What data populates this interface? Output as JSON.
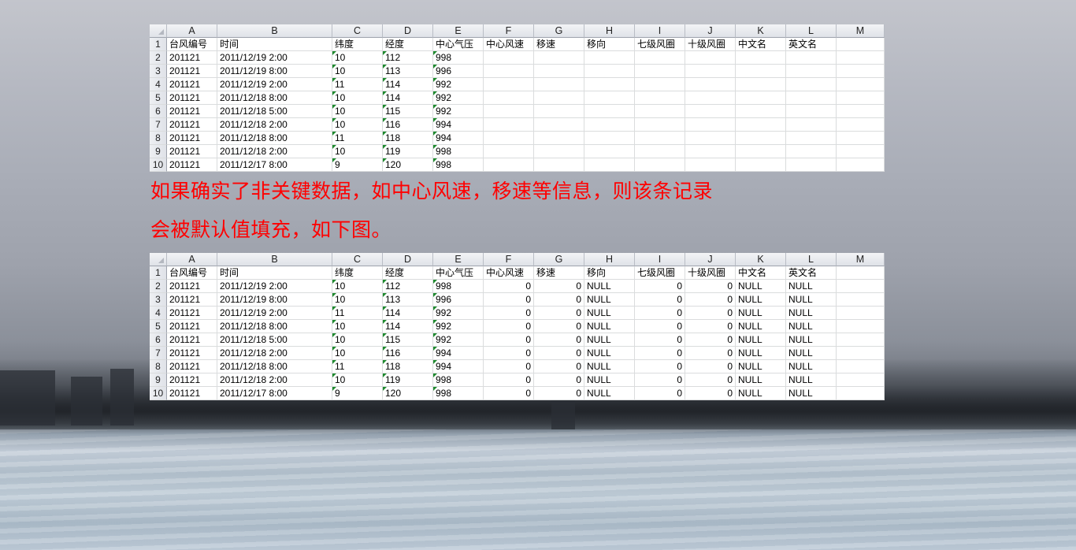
{
  "columns": [
    "A",
    "B",
    "C",
    "D",
    "E",
    "F",
    "G",
    "H",
    "I",
    "J",
    "K",
    "L",
    "M"
  ],
  "headers": [
    "台风编号",
    "时间",
    "纬度",
    "经度",
    "中心气压",
    "中心风速",
    "移速",
    "移向",
    "七级风圈",
    "十级风圈",
    "中文名",
    "英文名",
    ""
  ],
  "caption": {
    "line1": "如果确实了非关键数据，如中心风速，移速等信息，则该条记录",
    "line2": "会被默认值填充，如下图。"
  },
  "table_before": {
    "rows": [
      {
        "n": "2",
        "cells": [
          "201121",
          "2011/12/19 2:00",
          "10",
          "112",
          "998",
          "",
          "",
          "",
          "",
          "",
          "",
          "",
          ""
        ]
      },
      {
        "n": "3",
        "cells": [
          "201121",
          "2011/12/19 8:00",
          "10",
          "113",
          "996",
          "",
          "",
          "",
          "",
          "",
          "",
          "",
          ""
        ]
      },
      {
        "n": "4",
        "cells": [
          "201121",
          "2011/12/19 2:00",
          "11",
          "114",
          "992",
          "",
          "",
          "",
          "",
          "",
          "",
          "",
          ""
        ]
      },
      {
        "n": "5",
        "cells": [
          "201121",
          "2011/12/18 8:00",
          "10",
          "114",
          "992",
          "",
          "",
          "",
          "",
          "",
          "",
          "",
          ""
        ]
      },
      {
        "n": "6",
        "cells": [
          "201121",
          "2011/12/18 5:00",
          "10",
          "115",
          "992",
          "",
          "",
          "",
          "",
          "",
          "",
          "",
          ""
        ]
      },
      {
        "n": "7",
        "cells": [
          "201121",
          "2011/12/18 2:00",
          "10",
          "116",
          "994",
          "",
          "",
          "",
          "",
          "",
          "",
          "",
          ""
        ]
      },
      {
        "n": "8",
        "cells": [
          "201121",
          "2011/12/18 8:00",
          "11",
          "118",
          "994",
          "",
          "",
          "",
          "",
          "",
          "",
          "",
          ""
        ]
      },
      {
        "n": "9",
        "cells": [
          "201121",
          "2011/12/18 2:00",
          "10",
          "119",
          "998",
          "",
          "",
          "",
          "",
          "",
          "",
          "",
          ""
        ]
      },
      {
        "n": "10",
        "cells": [
          "201121",
          "2011/12/17 8:00",
          "9",
          "120",
          "998",
          "",
          "",
          "",
          "",
          "",
          "",
          "",
          ""
        ]
      }
    ]
  },
  "table_after": {
    "rows": [
      {
        "n": "2",
        "cells": [
          "201121",
          "2011/12/19 2:00",
          "10",
          "112",
          "998",
          "0",
          "0",
          "NULL",
          "0",
          "0",
          "NULL",
          "NULL",
          ""
        ]
      },
      {
        "n": "3",
        "cells": [
          "201121",
          "2011/12/19 8:00",
          "10",
          "113",
          "996",
          "0",
          "0",
          "NULL",
          "0",
          "0",
          "NULL",
          "NULL",
          ""
        ]
      },
      {
        "n": "4",
        "cells": [
          "201121",
          "2011/12/19 2:00",
          "11",
          "114",
          "992",
          "0",
          "0",
          "NULL",
          "0",
          "0",
          "NULL",
          "NULL",
          ""
        ]
      },
      {
        "n": "5",
        "cells": [
          "201121",
          "2011/12/18 8:00",
          "10",
          "114",
          "992",
          "0",
          "0",
          "NULL",
          "0",
          "0",
          "NULL",
          "NULL",
          ""
        ]
      },
      {
        "n": "6",
        "cells": [
          "201121",
          "2011/12/18 5:00",
          "10",
          "115",
          "992",
          "0",
          "0",
          "NULL",
          "0",
          "0",
          "NULL",
          "NULL",
          ""
        ]
      },
      {
        "n": "7",
        "cells": [
          "201121",
          "2011/12/18 2:00",
          "10",
          "116",
          "994",
          "0",
          "0",
          "NULL",
          "0",
          "0",
          "NULL",
          "NULL",
          ""
        ]
      },
      {
        "n": "8",
        "cells": [
          "201121",
          "2011/12/18 8:00",
          "11",
          "118",
          "994",
          "0",
          "0",
          "NULL",
          "0",
          "0",
          "NULL",
          "NULL",
          ""
        ]
      },
      {
        "n": "9",
        "cells": [
          "201121",
          "2011/12/18 2:00",
          "10",
          "119",
          "998",
          "0",
          "0",
          "NULL",
          "0",
          "0",
          "NULL",
          "NULL",
          ""
        ]
      },
      {
        "n": "10",
        "cells": [
          "201121",
          "2011/12/17 8:00",
          "9",
          "120",
          "998",
          "0",
          "0",
          "NULL",
          "0",
          "0",
          "NULL",
          "NULL",
          ""
        ]
      }
    ]
  }
}
